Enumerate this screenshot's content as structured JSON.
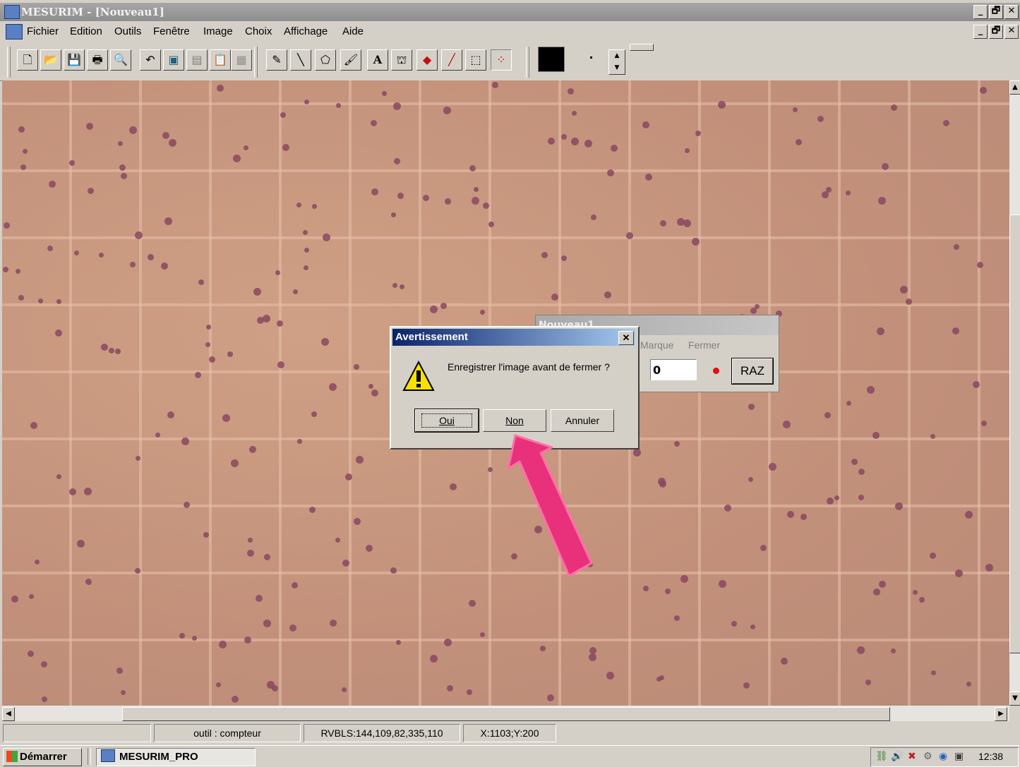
{
  "window": {
    "title": "MESURIM - [Nouveau1]",
    "controls": [
      "_",
      "🗗",
      "✕"
    ]
  },
  "menu": [
    "Fichier",
    "Edition",
    "Outils",
    "Fenêtre",
    "Image",
    "Choix",
    "Affichage",
    "Aide"
  ],
  "toolbar": {
    "file_tools": [
      "new-icon",
      "open-icon",
      "save-icon",
      "print-icon",
      "zoom-icon"
    ],
    "edit_tools": [
      "undo-icon",
      "image-icon",
      "image-gray-icon",
      "paste-icon",
      "disabled-icon"
    ],
    "draw_tools": [
      "pencil-icon",
      "line-icon",
      "lasso-icon",
      "brush-icon",
      "text-icon",
      "stamp-icon",
      "fill-icon",
      "eyedropper-icon",
      "select-rect-icon",
      "counter-icon"
    ],
    "color_swatch": "#000000"
  },
  "counter_window": {
    "title": "Nouveau1",
    "marque_label": "Marque",
    "fermer_label": "Fermer",
    "count_value": "0",
    "raz_label": "RAZ"
  },
  "dialog": {
    "title": "Avertissement",
    "message": "Enregistrer l'image avant de fermer ?",
    "oui_label": "Oui",
    "non_label": "Non",
    "annuler_label": "Annuler"
  },
  "statusbar": {
    "cell1": "",
    "tool": "outil : compteur",
    "rgb": "RVBLS:144,109,82,335,110",
    "coords": "X:1103;Y:200"
  },
  "taskbar": {
    "start_label": "Démarrer",
    "task_label": "MESURIM_PRO",
    "clock": "12:38"
  },
  "colors": {
    "image_bg": "#c2907a",
    "cell_dot": "#8a4860",
    "annotation_arrow": "#e8317a",
    "dialog_title": "#0a246a"
  }
}
